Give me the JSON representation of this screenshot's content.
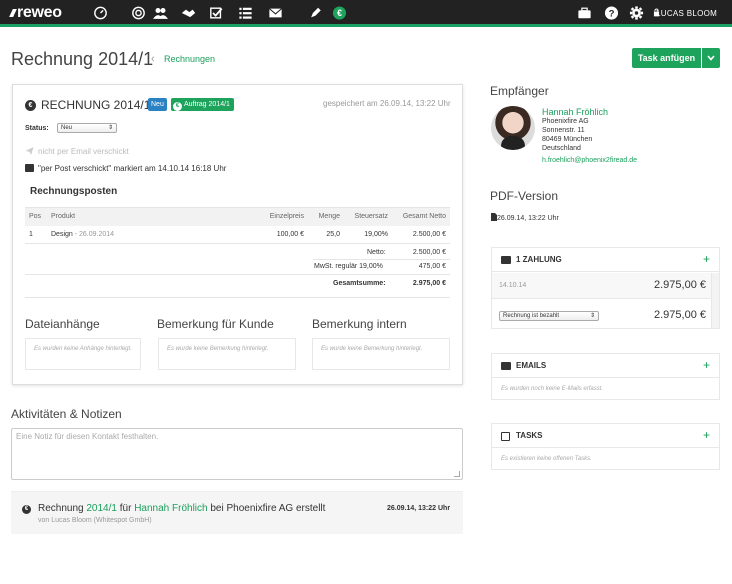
{
  "app": {
    "logo": "reweo",
    "user": "LUCAS BLOOM"
  },
  "header": {
    "title": "Rechnung 2014/1",
    "breadcrumb": "Rechnungen",
    "task_button": "Task anfügen"
  },
  "invoice": {
    "title": "RECHNUNG 2014/1",
    "badge_status": "Neu",
    "badge_order": "Auftrag 2014/1",
    "saved": "gespeichert am 26.09.14, 13:22 Uhr",
    "status_label": "Status:",
    "status_value": "Neu",
    "email_note": "nicht per Email verschickt",
    "post_note": "\"per Post verschickt\" markiert am 14.10.14 16:18 Uhr",
    "items_heading": "Rechnungsposten",
    "columns": [
      "Pos",
      "Produkt",
      "Einzelpreis",
      "Menge",
      "Steuersatz",
      "Gesamt Netto"
    ],
    "rows": [
      {
        "pos": "1",
        "product": "Design",
        "date": "- 26.09.2014",
        "price": "100,00 €",
        "qty": "25,0",
        "tax": "19,00%",
        "total": "2.500,00 €"
      }
    ],
    "netto_label": "Netto:",
    "netto_value": "2.500,00 €",
    "mwst_label": "MwSt. regulär 19,00%",
    "mwst_value": "475,00 €",
    "gesamt_label": "Gesamtsumme:",
    "gesamt_value": "2.975,00 €",
    "attachments_heading": "Dateianhänge",
    "attachments_empty": "Es wurden keine Anhänge hinterlegt.",
    "customer_note_heading": "Bemerkung für Kunde",
    "customer_note_empty": "Es wurde keine Bemerkung hinterlegt.",
    "internal_note_heading": "Bemerkung intern",
    "internal_note_empty": "Es wurde keine Bemerkung hinterlegt."
  },
  "activity": {
    "heading": "Aktivitäten & Notizen",
    "placeholder": "Eine Notiz für diesen Kontakt festhalten.",
    "entry_prefix": "Rechnung ",
    "entry_number": "2014/1",
    "entry_for": " für ",
    "entry_contact": "Hannah Fröhlich",
    "entry_suffix": " bei Phoenixfire AG erstellt",
    "entry_by": "von Lucas Bloom (Whitespot GmbH)",
    "entry_when": "26.09.14, 13:22 Uhr"
  },
  "recipient": {
    "heading": "Empfänger",
    "name": "Hannah Fröhlich",
    "company": "Phoenixfire AG",
    "street": "Sonnenstr. 11",
    "city": "80469 München",
    "country": "Deutschland",
    "email": "h.froehlich@phoenix2firead.de"
  },
  "pdf": {
    "heading": "PDF-Version",
    "file": "26.09.14, 13:22 Uhr"
  },
  "payments": {
    "heading": "1 ZAHLUNG",
    "date": "14.10.14",
    "amount": "2.975,00 €",
    "select_value": "Rechnung ist bezahlt",
    "amount2": "2.975,00 €"
  },
  "emails": {
    "heading": "EMAILS",
    "empty": "Es wurden noch keine E-Mails erfasst."
  },
  "tasks": {
    "heading": "TASKS",
    "empty": "Es existieren keine offenen Tasks."
  },
  "colors": {
    "accent": "#1ea35c",
    "topbar": "#222222",
    "badge_blue": "#2a82c3"
  }
}
